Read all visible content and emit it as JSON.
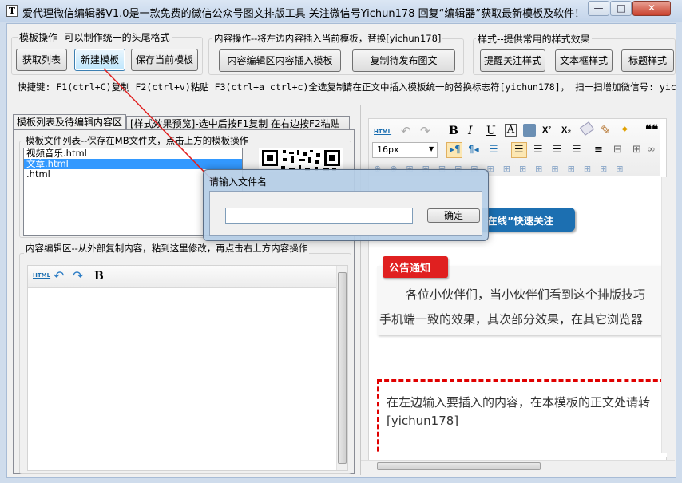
{
  "window": {
    "title": "爱代理微信编辑器V1.0是一款免费的微信公众号图文排版工具 关注微信号Yichun178 回复“编辑器”获取最新模板及软件！",
    "icon_letter": "T",
    "controls": {
      "minimize": "—",
      "maximize": "□",
      "close": "✕"
    }
  },
  "template_ops": {
    "title": "模板操作--可以制作统一的头尾格式",
    "buttons": [
      "获取列表",
      "新建模板",
      "保存当前模板"
    ]
  },
  "content_ops": {
    "title": "内容操作--将左边内容插入当前模板，替换[yichun178]",
    "buttons": [
      "内容编辑区内容插入模板",
      "复制待发布图文"
    ]
  },
  "style_ops": {
    "title": "样式--提供常用的样式效果",
    "buttons": [
      "提醒关注样式",
      "文本框样式",
      "标题样式"
    ]
  },
  "hints": {
    "shortcuts": "快捷键: F1(ctrl+C)复制  F2(ctrl+v)粘贴 F3(ctrl+a ctrl+c)全选复制",
    "insert_note": "请在正文中插入模板统一的替换标志符[yichun178]， 扫一扫增加微信号: yic"
  },
  "tabs": [
    "模板列表及待编辑内容区",
    "[样式效果预览]-选中后按F1复制 在右边按F2粘贴"
  ],
  "file_list": {
    "title": "模板文件列表--保存在MB文件夹，点击上方的模板操作",
    "items": [
      "视频音乐.html",
      "文章.html",
      ".html"
    ],
    "selected_index": 1
  },
  "content_editor": {
    "title": "内容编辑区--从外部复制内容，粘到这里修改，再点击右上方内容操作",
    "toolbar": {
      "html_label": "HTML",
      "undo_icon": "↶",
      "redo_icon": "↷",
      "bold_label": "B"
    }
  },
  "right_editor": {
    "toolbar_row1": {
      "html_label": "HTML",
      "bold": "B",
      "italic": "I",
      "underline": "U",
      "font_color": "A",
      "sup": "X²",
      "sub": "X₂",
      "quote": "❝❝"
    },
    "font_size": "16px",
    "follow_banner": "在线”快速关注",
    "notice_badge": "公告通知",
    "notice_line1": "各位小伙伴们，当小伙伴们看到这个排版技巧",
    "notice_line2": "手机端一致的效果，其次部分效果，在其它浏览器",
    "body_line1": "在左边输入要插入的内容，在本模板的正文处请转",
    "body_line2": "[yichun178]"
  },
  "dialog": {
    "title": "请输入文件名",
    "input_value": "",
    "ok_label": "确定"
  },
  "colors": {
    "accent_blue": "#1c6fb1",
    "notice_red": "#e02020",
    "dash_red": "#e00000",
    "selection": "#3399ff"
  }
}
